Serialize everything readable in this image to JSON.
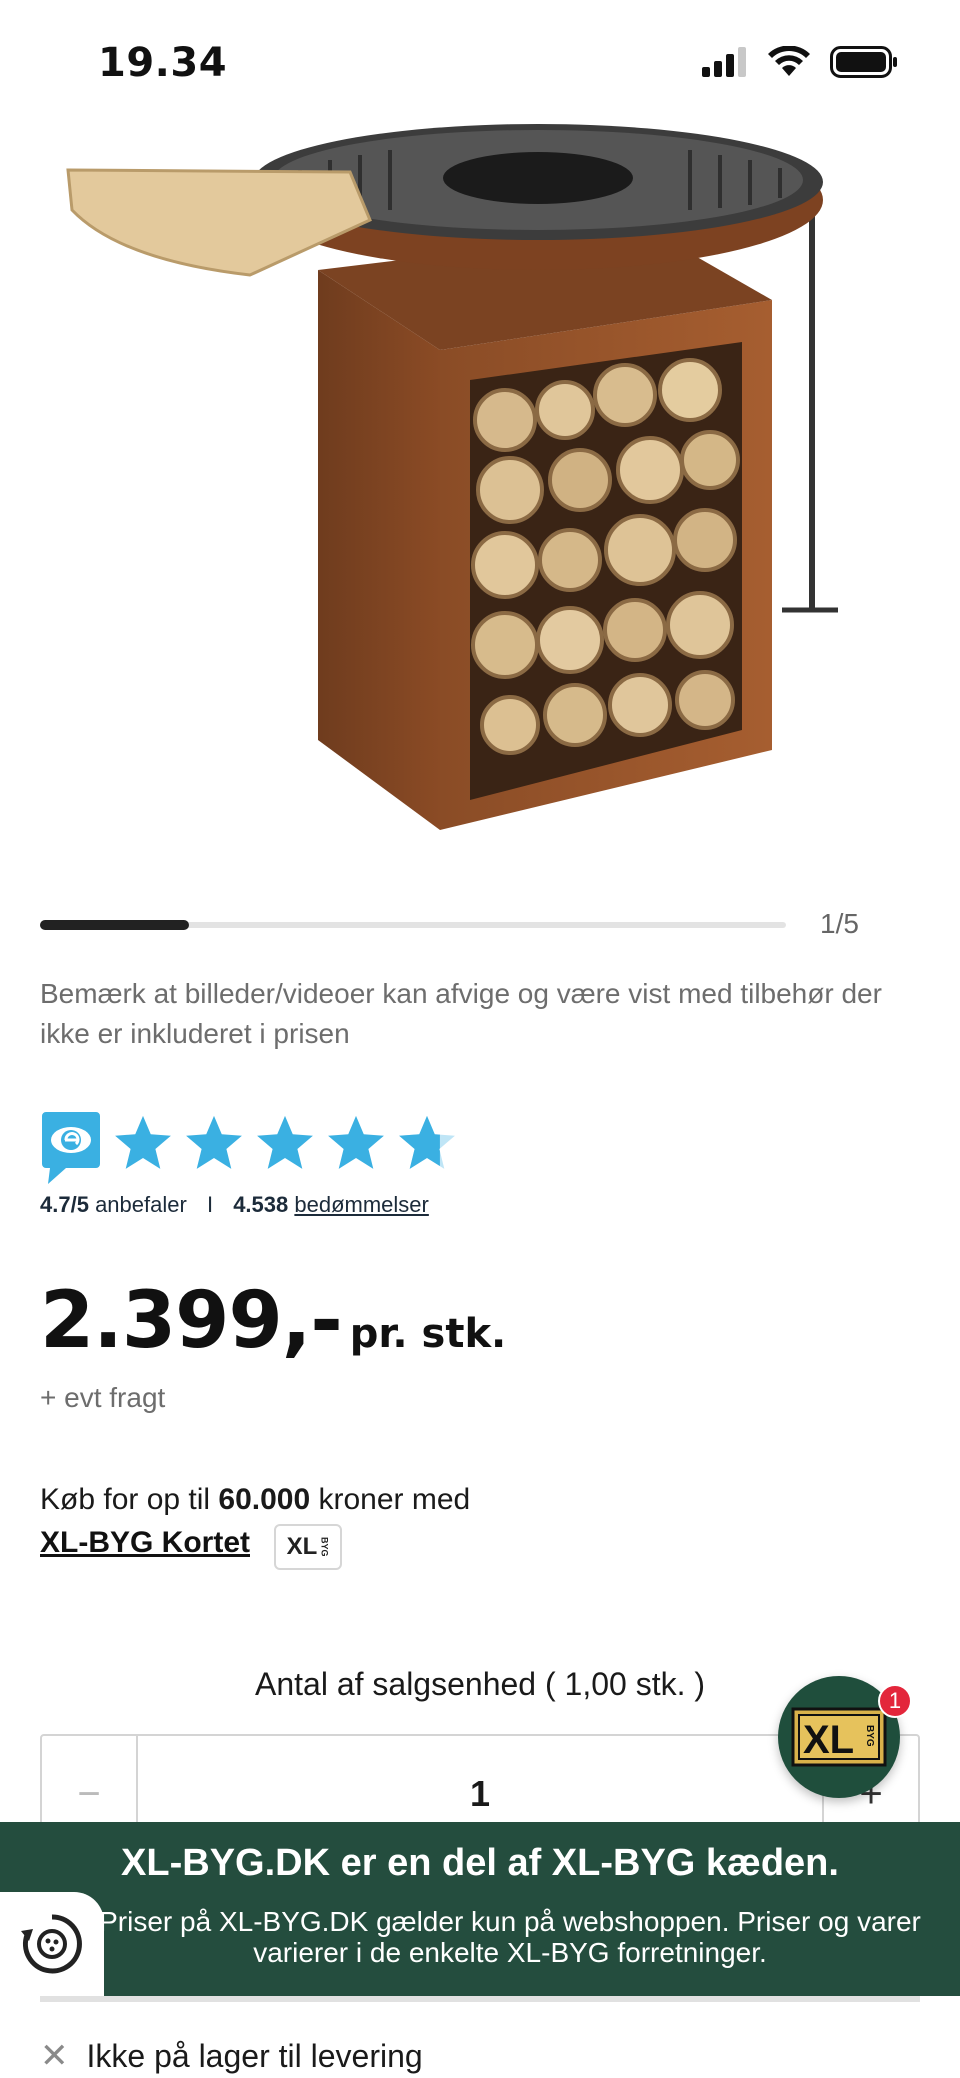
{
  "status_bar": {
    "time": "19.34"
  },
  "gallery": {
    "counter": "1/5",
    "progress": 0.2
  },
  "disclaimer": "Bemærk at billeder/videoer kan afvige og være vist med tilbehør der ikke er inkluderet i prisen",
  "rating": {
    "score": "4.7/5",
    "recommend_label": "anbefaler",
    "separator": "I",
    "count": "4.538",
    "reviews_link": "bedømmelser",
    "stars": 4.7
  },
  "price": {
    "amount": "2.399,-",
    "unit": "pr. stk.",
    "freight": "+ evt fragt"
  },
  "credit": {
    "prefix": "Køb for op til ",
    "amount": "60.000",
    "suffix": " kroner med",
    "card_link": "XL-BYG Kortet ",
    "card_logo": "XL",
    "card_logo_small": "BYG"
  },
  "quantity": {
    "label": "Antal af salgsenhed ( 1,00 stk. )",
    "value": "1",
    "minus": "−",
    "plus": "+"
  },
  "fab": {
    "logo": "XL",
    "logo_small": "BYG",
    "badge": "1"
  },
  "banner": {
    "title": "XL-BYG.DK er en del af XL-BYG kæden.",
    "text": "Priser på XL-BYG.DK gælder kun på webshoppen. Priser og varer varierer i de enkelte XL-BYG forretninger."
  },
  "stock": {
    "icon": "✕",
    "text": "Ikke på lager til levering"
  },
  "colors": {
    "brand_green": "#244d3e",
    "star_blue": "#3ab0e2",
    "badge_red": "#e3263b"
  }
}
